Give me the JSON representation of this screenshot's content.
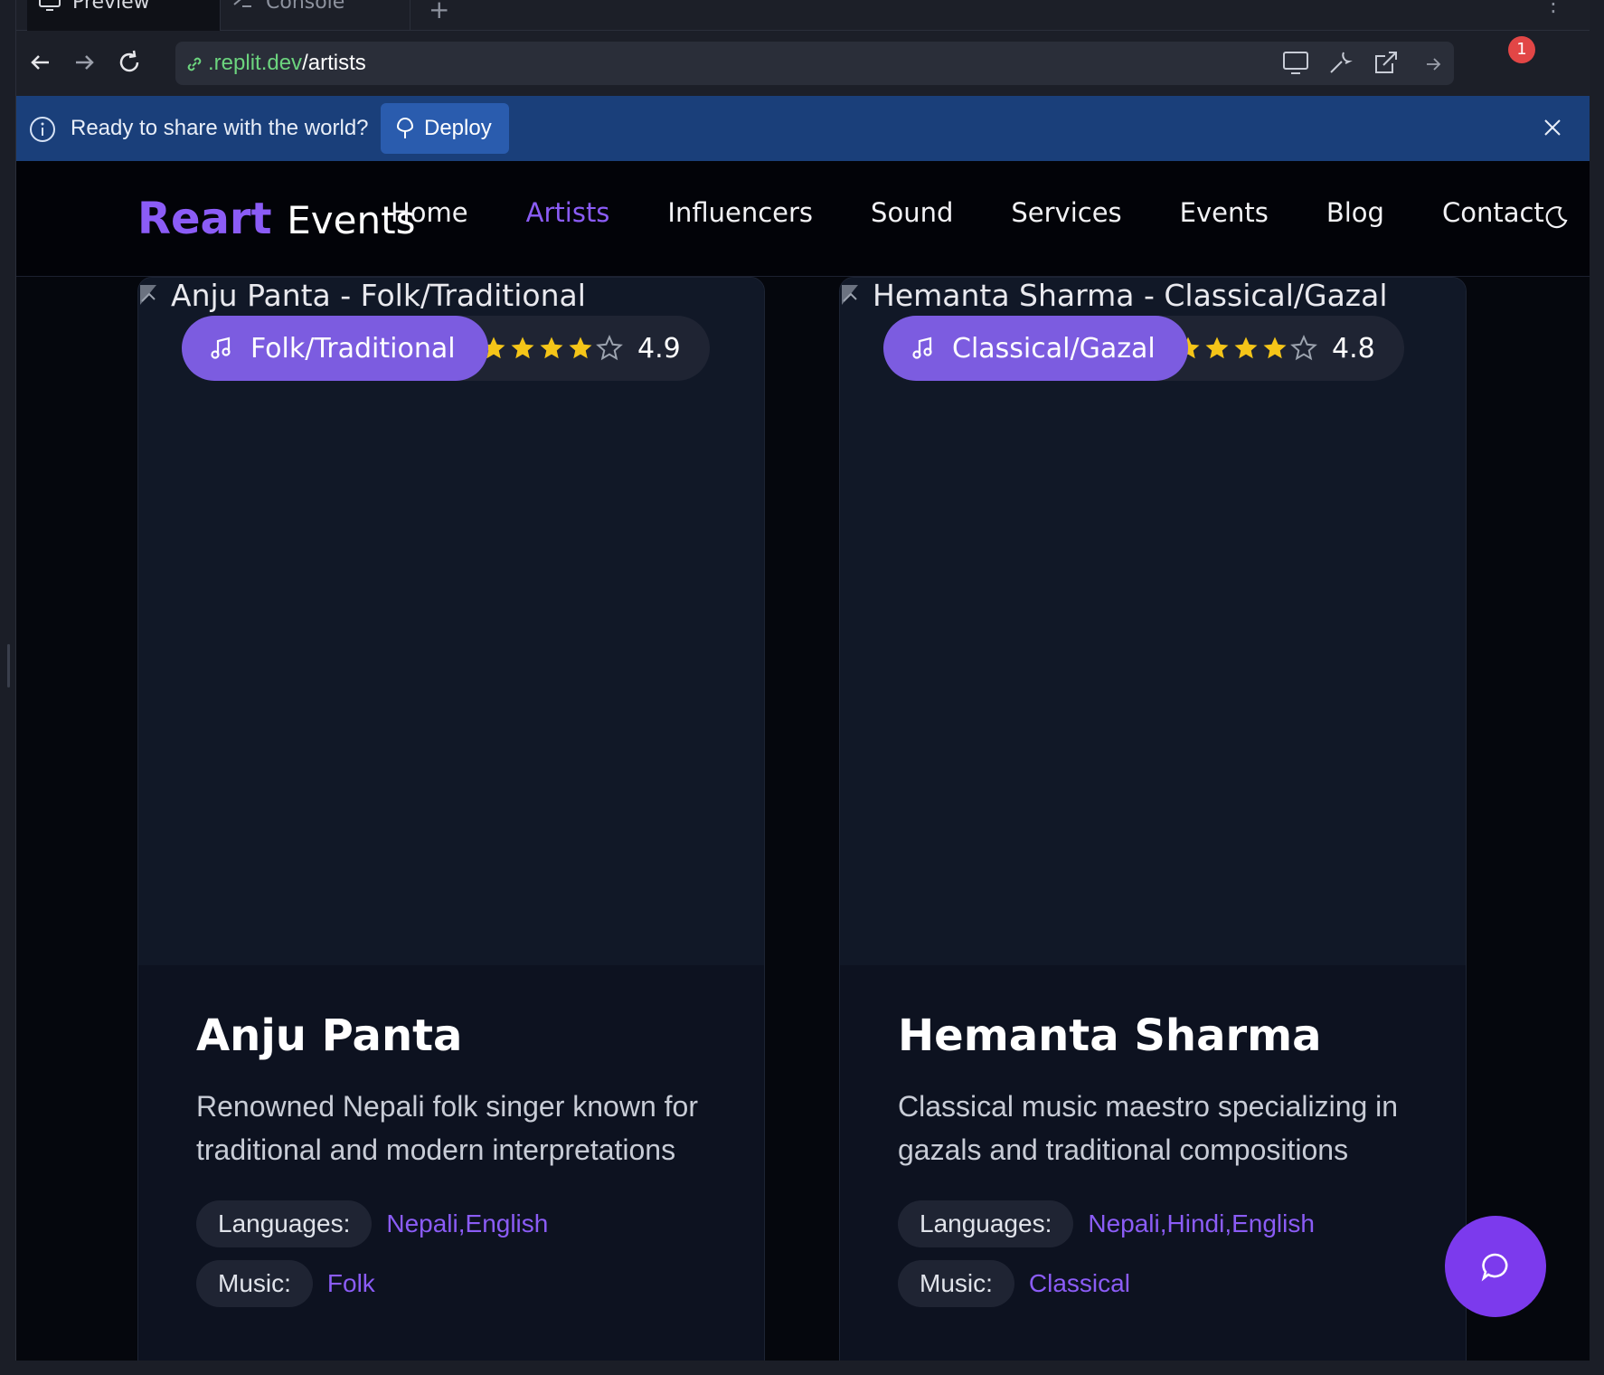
{
  "ide": {
    "tabs": [
      {
        "label": "Preview",
        "icon": "monitor-icon"
      },
      {
        "label": "Console",
        "icon": "terminal-icon"
      }
    ],
    "url": {
      "domain": ".replit.dev",
      "path": "/artists"
    },
    "notification_count": "1"
  },
  "banner": {
    "message": "Ready to share with the world?",
    "deploy_label": "Deploy"
  },
  "site": {
    "brand_primary": "Reart",
    "brand_secondary": "Events",
    "accent_color": "#8b5cf6",
    "nav": [
      {
        "label": "Home",
        "active": false
      },
      {
        "label": "Artists",
        "active": true
      },
      {
        "label": "Influencers",
        "active": false
      },
      {
        "label": "Sound",
        "active": false
      },
      {
        "label": "Services",
        "active": false
      },
      {
        "label": "Events",
        "active": false
      },
      {
        "label": "Blog",
        "active": false
      },
      {
        "label": "Contact",
        "active": false
      }
    ]
  },
  "artists": [
    {
      "image_alt": "Anju Panta - Folk/Traditional",
      "genre": "Folk/Traditional",
      "rating": "4.9",
      "stars_filled": 4,
      "name": "Anju Panta",
      "description": "Renowned Nepali folk singer known for traditional and modern interpretations",
      "languages_label": "Languages:",
      "languages": "Nepali,English",
      "music_label": "Music:",
      "music": "Folk"
    },
    {
      "image_alt": "Hemanta Sharma - Classical/Gazal",
      "genre": "Classical/Gazal",
      "rating": "4.8",
      "stars_filled": 4,
      "name": "Hemanta Sharma",
      "description": "Classical music maestro specializing in gazals and traditional compositions",
      "languages_label": "Languages:",
      "languages": "Nepali,Hindi,English",
      "music_label": "Music:",
      "music": "Classical"
    }
  ]
}
